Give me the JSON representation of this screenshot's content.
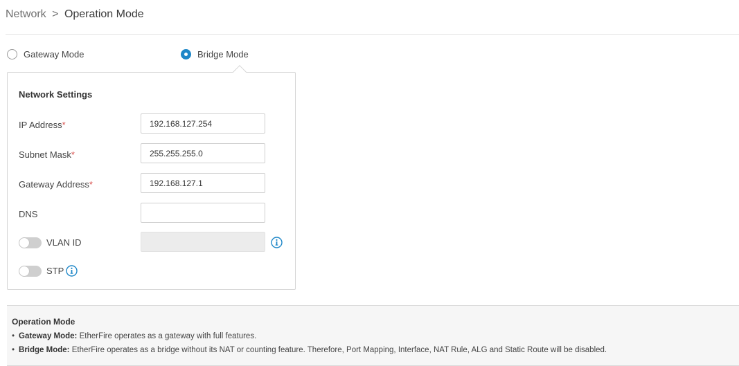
{
  "breadcrumb": {
    "parent": "Network",
    "separator": ">",
    "current": "Operation Mode"
  },
  "modes": {
    "gateway_label": "Gateway Mode",
    "bridge_label": "Bridge Mode",
    "selected": "Bridge Mode"
  },
  "settings": {
    "title": "Network Settings",
    "required_marker": "*",
    "ip_label": "IP Address",
    "ip_value": "192.168.127.254",
    "subnet_label": "Subnet Mask",
    "subnet_value": "255.255.255.0",
    "gateway_label": "Gateway Address",
    "gateway_value": "192.168.127.1",
    "dns_label": "DNS",
    "dns_value": "",
    "vlan_label": "VLAN ID",
    "vlan_enabled": false,
    "vlan_value": "",
    "stp_label": "STP",
    "stp_enabled": false
  },
  "operation_info": {
    "title": "Operation Mode",
    "items": [
      {
        "term": "Gateway Mode:",
        "desc": " EtherFire operates as a gateway with full features."
      },
      {
        "term": "Bridge Mode:",
        "desc": " EtherFire operates as a bridge without its NAT or counting feature. Therefore, Port Mapping, Interface, NAT Rule, ALG and Static Route will be disabled."
      }
    ]
  },
  "colors": {
    "accent": "#1e87c8",
    "required": "#d9534f",
    "toggle_off": "#cfcfcf",
    "info_icon": "#1e87c8"
  },
  "icons": {
    "info": "info-icon",
    "bullet": "bullet-dot"
  }
}
